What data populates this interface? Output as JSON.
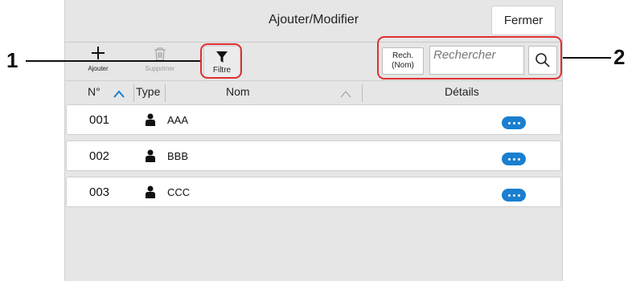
{
  "dialog": {
    "title": "Ajouter/Modifier",
    "close_label": "Fermer"
  },
  "toolbar": {
    "add_label": "Ajouter",
    "delete_label": "Supprimer",
    "filter_label": "Filtre"
  },
  "search": {
    "mode_line1": "Rech.",
    "mode_line2": "(Nom)",
    "placeholder": "Rechercher"
  },
  "table": {
    "columns": {
      "number": "N°",
      "type": "Type",
      "name": "Nom",
      "details": "Détails"
    },
    "rows": [
      {
        "number": "001",
        "name": "AAA"
      },
      {
        "number": "002",
        "name": "BBB"
      },
      {
        "number": "003",
        "name": "CCC"
      }
    ]
  },
  "callouts": {
    "one": "1",
    "two": "2"
  },
  "colors": {
    "accent": "#1a7fd0",
    "panel": "#e6e6e6"
  }
}
